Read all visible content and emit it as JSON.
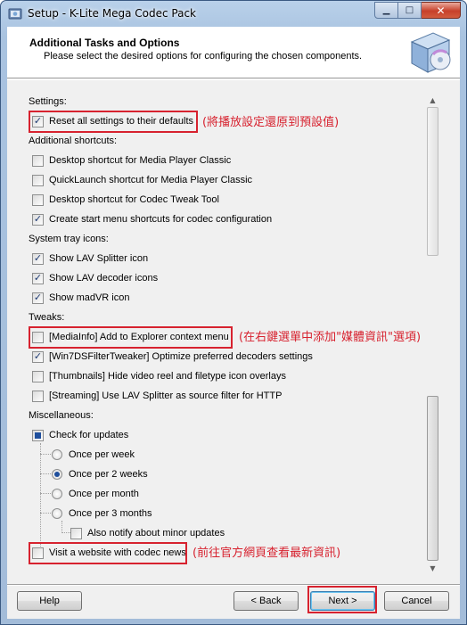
{
  "window": {
    "title": "Setup - K-Lite Mega Codec Pack",
    "minimize_glyph": "▁",
    "maximize_glyph": "□",
    "close_glyph": "✕"
  },
  "header": {
    "title": "Additional Tasks and Options",
    "subtitle": "Please select the desired options for configuring the chosen components."
  },
  "settings": {
    "label": "Settings:",
    "reset_defaults": {
      "label": "Reset all settings to their defaults",
      "checked": true
    }
  },
  "shortcuts": {
    "label": "Additional shortcuts:",
    "items": [
      {
        "label": "Desktop shortcut for Media Player Classic",
        "checked": false
      },
      {
        "label": "QuickLaunch shortcut for Media Player Classic",
        "checked": false
      },
      {
        "label": "Desktop shortcut for Codec Tweak Tool",
        "checked": false
      },
      {
        "label": "Create start menu shortcuts for codec configuration",
        "checked": true
      }
    ]
  },
  "tray": {
    "label": "System tray icons:",
    "items": [
      {
        "label": "Show LAV Splitter icon",
        "checked": true
      },
      {
        "label": "Show LAV decoder icons",
        "checked": true
      },
      {
        "label": "Show madVR icon",
        "checked": true
      }
    ]
  },
  "tweaks": {
    "label": "Tweaks:",
    "items": [
      {
        "label": "[MediaInfo] Add to Explorer context menu",
        "checked": false
      },
      {
        "label": "[Win7DSFilterTweaker] Optimize preferred decoders settings",
        "checked": true
      },
      {
        "label": "[Thumbnails] Hide video reel and filetype icon overlays",
        "checked": false
      },
      {
        "label": "[Streaming] Use LAV Splitter as source filter for HTTP",
        "checked": false
      }
    ]
  },
  "misc": {
    "label": "Miscellaneous:",
    "check_updates": {
      "label": "Check for updates",
      "state": "partial"
    },
    "frequency": [
      {
        "label": "Once per week",
        "selected": false
      },
      {
        "label": "Once per 2 weeks",
        "selected": true
      },
      {
        "label": "Once per month",
        "selected": false
      },
      {
        "label": "Once per 3 months",
        "selected": false
      }
    ],
    "minor_updates": {
      "label": "Also notify about minor updates",
      "checked": false
    },
    "visit_website": {
      "label": "Visit a website with codec news",
      "checked": false
    }
  },
  "annotations": {
    "reset_note": "(將播放設定還原到預設值)",
    "mediainfo_note": "(在右鍵選單中添加\"媒體資訊\"選項)",
    "website_note": "(前往官方網頁查看最新資訊)"
  },
  "buttons": {
    "help": "Help",
    "back": "< Back",
    "next": "Next >",
    "cancel": "Cancel"
  },
  "colors": {
    "annotation_red": "#d7222f",
    "checkbox_mark": "#1f4f9d"
  }
}
